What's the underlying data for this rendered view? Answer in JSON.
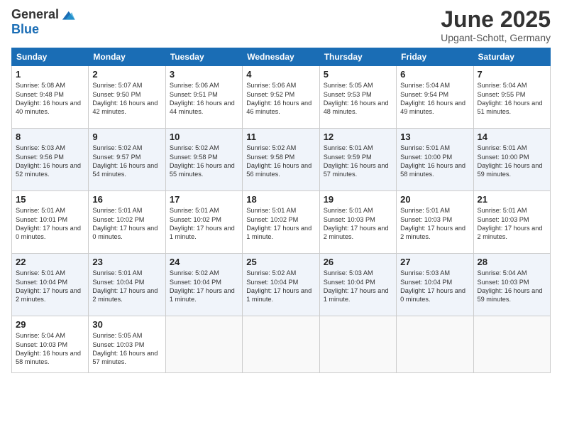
{
  "header": {
    "logo_general": "General",
    "logo_blue": "Blue",
    "month_year": "June 2025",
    "location": "Upgant-Schott, Germany"
  },
  "days_of_week": [
    "Sunday",
    "Monday",
    "Tuesday",
    "Wednesday",
    "Thursday",
    "Friday",
    "Saturday"
  ],
  "weeks": [
    [
      {
        "day": "1",
        "sunrise": "5:08 AM",
        "sunset": "9:48 PM",
        "daylight": "16 hours and 40 minutes."
      },
      {
        "day": "2",
        "sunrise": "5:07 AM",
        "sunset": "9:50 PM",
        "daylight": "16 hours and 42 minutes."
      },
      {
        "day": "3",
        "sunrise": "5:06 AM",
        "sunset": "9:51 PM",
        "daylight": "16 hours and 44 minutes."
      },
      {
        "day": "4",
        "sunrise": "5:06 AM",
        "sunset": "9:52 PM",
        "daylight": "16 hours and 46 minutes."
      },
      {
        "day": "5",
        "sunrise": "5:05 AM",
        "sunset": "9:53 PM",
        "daylight": "16 hours and 48 minutes."
      },
      {
        "day": "6",
        "sunrise": "5:04 AM",
        "sunset": "9:54 PM",
        "daylight": "16 hours and 49 minutes."
      },
      {
        "day": "7",
        "sunrise": "5:04 AM",
        "sunset": "9:55 PM",
        "daylight": "16 hours and 51 minutes."
      }
    ],
    [
      {
        "day": "8",
        "sunrise": "5:03 AM",
        "sunset": "9:56 PM",
        "daylight": "16 hours and 52 minutes."
      },
      {
        "day": "9",
        "sunrise": "5:02 AM",
        "sunset": "9:57 PM",
        "daylight": "16 hours and 54 minutes."
      },
      {
        "day": "10",
        "sunrise": "5:02 AM",
        "sunset": "9:58 PM",
        "daylight": "16 hours and 55 minutes."
      },
      {
        "day": "11",
        "sunrise": "5:02 AM",
        "sunset": "9:58 PM",
        "daylight": "16 hours and 56 minutes."
      },
      {
        "day": "12",
        "sunrise": "5:01 AM",
        "sunset": "9:59 PM",
        "daylight": "16 hours and 57 minutes."
      },
      {
        "day": "13",
        "sunrise": "5:01 AM",
        "sunset": "10:00 PM",
        "daylight": "16 hours and 58 minutes."
      },
      {
        "day": "14",
        "sunrise": "5:01 AM",
        "sunset": "10:00 PM",
        "daylight": "16 hours and 59 minutes."
      }
    ],
    [
      {
        "day": "15",
        "sunrise": "5:01 AM",
        "sunset": "10:01 PM",
        "daylight": "17 hours and 0 minutes."
      },
      {
        "day": "16",
        "sunrise": "5:01 AM",
        "sunset": "10:02 PM",
        "daylight": "17 hours and 0 minutes."
      },
      {
        "day": "17",
        "sunrise": "5:01 AM",
        "sunset": "10:02 PM",
        "daylight": "17 hours and 1 minute."
      },
      {
        "day": "18",
        "sunrise": "5:01 AM",
        "sunset": "10:02 PM",
        "daylight": "17 hours and 1 minute."
      },
      {
        "day": "19",
        "sunrise": "5:01 AM",
        "sunset": "10:03 PM",
        "daylight": "17 hours and 2 minutes."
      },
      {
        "day": "20",
        "sunrise": "5:01 AM",
        "sunset": "10:03 PM",
        "daylight": "17 hours and 2 minutes."
      },
      {
        "day": "21",
        "sunrise": "5:01 AM",
        "sunset": "10:03 PM",
        "daylight": "17 hours and 2 minutes."
      }
    ],
    [
      {
        "day": "22",
        "sunrise": "5:01 AM",
        "sunset": "10:04 PM",
        "daylight": "17 hours and 2 minutes."
      },
      {
        "day": "23",
        "sunrise": "5:01 AM",
        "sunset": "10:04 PM",
        "daylight": "17 hours and 2 minutes."
      },
      {
        "day": "24",
        "sunrise": "5:02 AM",
        "sunset": "10:04 PM",
        "daylight": "17 hours and 1 minute."
      },
      {
        "day": "25",
        "sunrise": "5:02 AM",
        "sunset": "10:04 PM",
        "daylight": "17 hours and 1 minute."
      },
      {
        "day": "26",
        "sunrise": "5:03 AM",
        "sunset": "10:04 PM",
        "daylight": "17 hours and 1 minute."
      },
      {
        "day": "27",
        "sunrise": "5:03 AM",
        "sunset": "10:04 PM",
        "daylight": "17 hours and 0 minutes."
      },
      {
        "day": "28",
        "sunrise": "5:04 AM",
        "sunset": "10:03 PM",
        "daylight": "16 hours and 59 minutes."
      }
    ],
    [
      {
        "day": "29",
        "sunrise": "5:04 AM",
        "sunset": "10:03 PM",
        "daylight": "16 hours and 58 minutes."
      },
      {
        "day": "30",
        "sunrise": "5:05 AM",
        "sunset": "10:03 PM",
        "daylight": "16 hours and 57 minutes."
      },
      null,
      null,
      null,
      null,
      null
    ]
  ]
}
